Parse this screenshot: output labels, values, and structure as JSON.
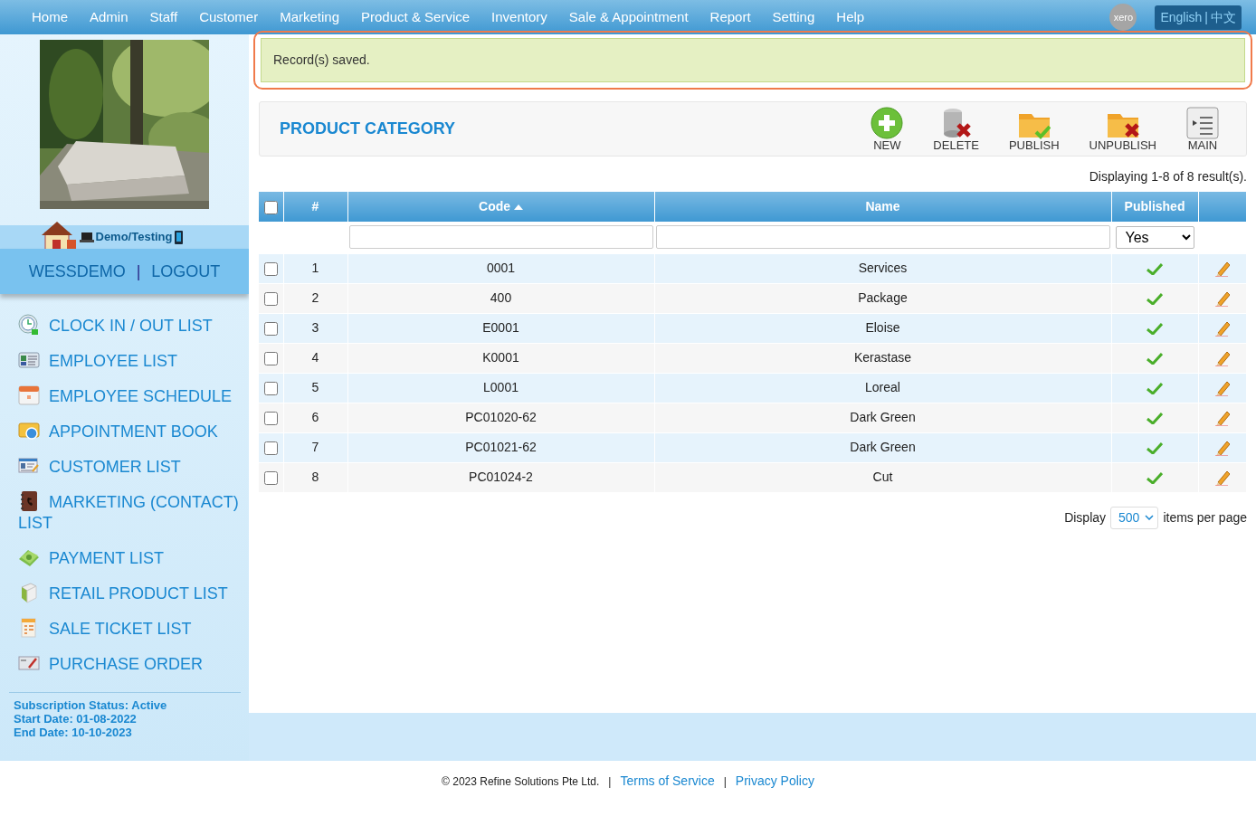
{
  "nav": {
    "items": [
      "Home",
      "Admin",
      "Staff",
      "Customer",
      "Marketing",
      "Product & Service",
      "Inventory",
      "Sale & Appointment",
      "Report",
      "Setting",
      "Help"
    ],
    "xero": "xero",
    "language": {
      "english": "English",
      "separator": "|",
      "chinese": "中文"
    }
  },
  "sidebar": {
    "site": "Demo/Testing",
    "user": "WESSDEMO",
    "separator": "|",
    "logout": "LOGOUT",
    "menu": [
      {
        "label": "CLOCK IN / OUT LIST",
        "kind": "clock"
      },
      {
        "label": "EMPLOYEE LIST",
        "kind": "ids"
      },
      {
        "label": "EMPLOYEE SCHEDULE",
        "kind": "calendar"
      },
      {
        "label": "APPOINTMENT BOOK",
        "kind": "book"
      },
      {
        "label": "CUSTOMER LIST",
        "kind": "card"
      },
      {
        "label": "MARKETING (CONTACT) LIST",
        "kind": "contacts"
      },
      {
        "label": "PAYMENT LIST",
        "kind": "money"
      },
      {
        "label": "RETAIL PRODUCT LIST",
        "kind": "product"
      },
      {
        "label": "SALE TICKET LIST",
        "kind": "ticket"
      },
      {
        "label": "PURCHASE ORDER",
        "kind": "order"
      }
    ],
    "subscription": [
      "Subscription Status: Active",
      "Start Date: 01-08-2022",
      "End Date: 10-10-2023"
    ]
  },
  "alert": "Record(s) saved.",
  "page_title": "PRODUCT CATEGORY",
  "toolbar": [
    {
      "label": "NEW",
      "kind": "new"
    },
    {
      "label": "DELETE",
      "kind": "delete"
    },
    {
      "label": "PUBLISH",
      "kind": "publish"
    },
    {
      "label": "UNPUBLISH",
      "kind": "unpublish"
    },
    {
      "label": "MAIN",
      "kind": "main"
    }
  ],
  "result_info": "Displaying 1-8 of 8 result(s).",
  "table": {
    "select_all_checked": false,
    "columns": [
      {
        "label": "#",
        "sorted": false
      },
      {
        "label": "Code",
        "sorted": true
      },
      {
        "label": "Name",
        "sorted": false
      },
      {
        "label": "Published",
        "sorted": false
      }
    ],
    "filter_published": "Yes",
    "rows": [
      {
        "checked": false,
        "number": "1",
        "code": "0001",
        "name": "Services",
        "published": true
      },
      {
        "checked": false,
        "number": "2",
        "code": "400",
        "name": "Package",
        "published": true
      },
      {
        "checked": false,
        "number": "3",
        "code": "E0001",
        "name": "Eloise",
        "published": true
      },
      {
        "checked": false,
        "number": "4",
        "code": "K0001",
        "name": "Kerastase",
        "published": true
      },
      {
        "checked": false,
        "number": "5",
        "code": "L0001",
        "name": "Loreal",
        "published": true
      },
      {
        "checked": false,
        "number": "6",
        "code": "PC01020-62",
        "name": "Dark Green",
        "published": true
      },
      {
        "checked": false,
        "number": "7",
        "code": "PC01021-62",
        "name": "Dark Green",
        "published": true
      },
      {
        "checked": false,
        "number": "8",
        "code": "PC01024-2",
        "name": "Cut",
        "published": true
      }
    ]
  },
  "pagination": {
    "label": "Display",
    "per_page": "500",
    "suffix": "items per page"
  },
  "footer": [
    {
      "kind": "text",
      "text": "© 2023 Refine Solutions Pte Ltd."
    },
    {
      "kind": "separator",
      "text": "|"
    },
    {
      "kind": "link",
      "text": "Terms of Service"
    },
    {
      "kind": "separator",
      "text": "|"
    },
    {
      "kind": "link",
      "text": "Privacy Policy"
    }
  ]
}
